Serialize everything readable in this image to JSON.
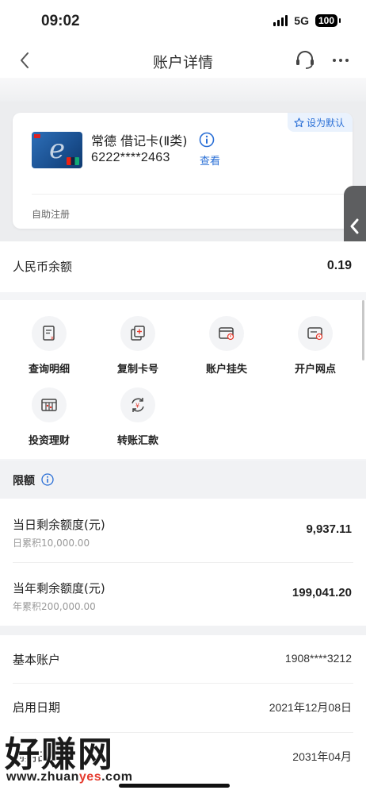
{
  "status_bar": {
    "time": "09:02",
    "network": "5G",
    "battery": "100"
  },
  "nav": {
    "title": "账户详情",
    "back_icon": "chevron-left-icon",
    "service_icon": "headset-icon",
    "more_icon": "more-dots-icon"
  },
  "card": {
    "name": "常德 借记卡(Ⅱ类)",
    "number": "6222****2463",
    "view_label": "查看",
    "set_default_label": "设为默认",
    "registration": "自助注册"
  },
  "balance": {
    "label": "人民币余额",
    "value": "0.19"
  },
  "actions": [
    {
      "label": "查询明细",
      "icon": "statement-icon"
    },
    {
      "label": "复制卡号",
      "icon": "copy-icon"
    },
    {
      "label": "账户挂失",
      "icon": "report-loss-icon"
    },
    {
      "label": "开户网点",
      "icon": "branch-icon"
    },
    {
      "label": "投资理财",
      "icon": "invest-icon"
    },
    {
      "label": "转账汇款",
      "icon": "transfer-icon"
    }
  ],
  "limits": {
    "title": "限额",
    "rows": [
      {
        "label": "当日剩余额度(元)",
        "sub": "日累积10,000.00",
        "value": "9,937.11"
      },
      {
        "label": "当年剩余额度(元)",
        "sub": "年累积200,000.00",
        "value": "199,041.20"
      }
    ]
  },
  "info": [
    {
      "label": "基本账户",
      "value": "1908****3212"
    },
    {
      "label": "启用日期",
      "value": "2021年12月08日"
    },
    {
      "label": "到期日期",
      "value": "2031年04月"
    }
  ],
  "watermark": {
    "main": "好赚网",
    "url_prefix": "www.zhuan",
    "url_highlight": "yes",
    "url_suffix": ".com"
  },
  "colors": {
    "accent": "#2a6fd6",
    "side_tab": "#5d5e60"
  }
}
